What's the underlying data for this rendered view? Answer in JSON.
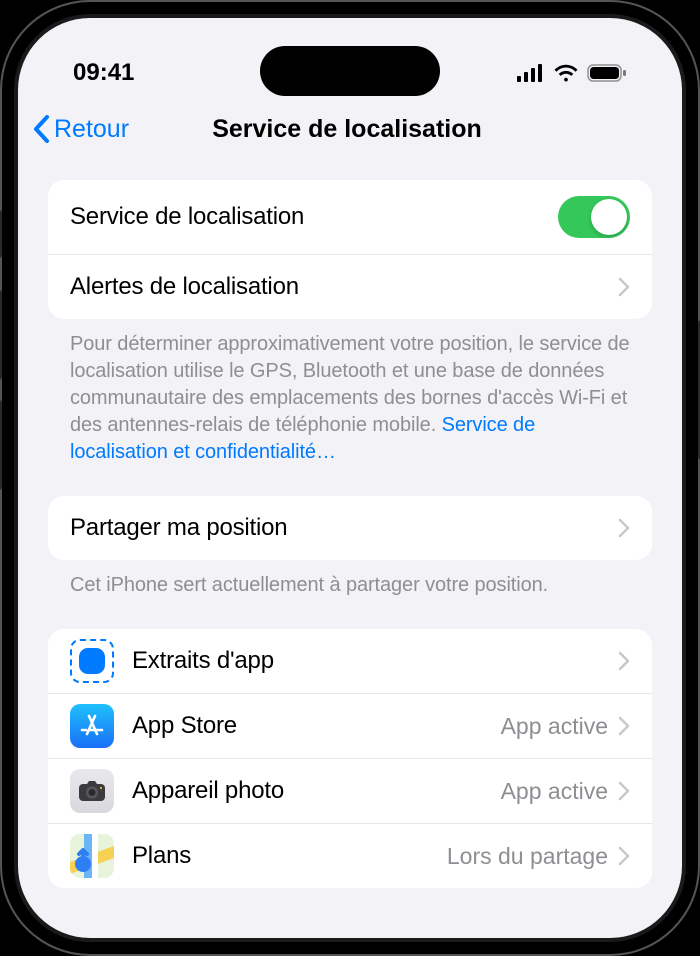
{
  "status": {
    "time": "09:41"
  },
  "nav": {
    "back": "Retour",
    "title": "Service de localisation"
  },
  "group1": {
    "toggle_label": "Service de localisation",
    "alerts_label": "Alertes de localisation",
    "footer_text": "Pour déterminer approximativement votre position, le service de localisation utilise le GPS, Bluetooth et une base de données communautaire des emplacements des bornes d'accès Wi-Fi et des antennes-relais de téléphonie mobile. ",
    "footer_link": "Service de localisation et confidentialité…"
  },
  "group2": {
    "share_label": "Partager ma position",
    "footer": "Cet iPhone sert actuellement à partager votre position."
  },
  "apps": [
    {
      "name": "Extraits d'app",
      "detail": "",
      "icon": "clips"
    },
    {
      "name": "App Store",
      "detail": "App active",
      "icon": "appstore"
    },
    {
      "name": "Appareil photo",
      "detail": "App active",
      "icon": "camera"
    },
    {
      "name": "Plans",
      "detail": "Lors du partage",
      "icon": "maps"
    }
  ]
}
